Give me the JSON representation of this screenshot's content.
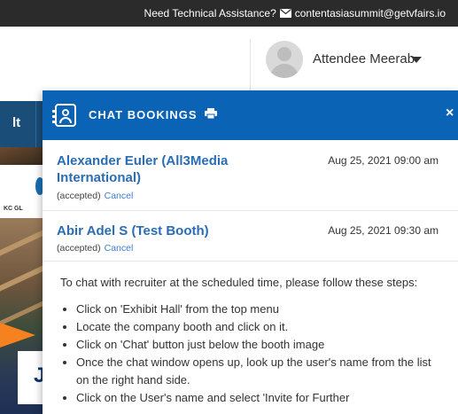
{
  "topbar": {
    "assist_text": "Need Technical Assistance?",
    "email": "contentasiasummit@getvfairs.io"
  },
  "user": {
    "name": "Attendee Meerab"
  },
  "background": {
    "nav_text": "lt",
    "logo_text": "KC GL",
    "board_letter": "J"
  },
  "modal": {
    "title": "CHAT BOOKINGS",
    "close": "×",
    "bookings": [
      {
        "name": "Alexander Euler (All3Media International)",
        "date": "Aug 25, 2021 09:00 am",
        "status": "(accepted)",
        "cancel": "Cancel"
      },
      {
        "name": "Abir Adel S (Test Booth)",
        "date": "Aug 25, 2021 09:30 am",
        "status": "(accepted)",
        "cancel": "Cancel"
      }
    ],
    "instructions_intro": "To chat with recruiter at the scheduled time, please follow these steps:",
    "steps": [
      "Click on 'Exhibit Hall' from the top menu",
      "Locate the company booth and click on it.",
      "Click on 'Chat' button just below the booth image",
      "Once the chat window opens up, look up the user's name from the list on the right hand side.",
      "Click on the User's name and select 'Invite for Further"
    ]
  }
}
